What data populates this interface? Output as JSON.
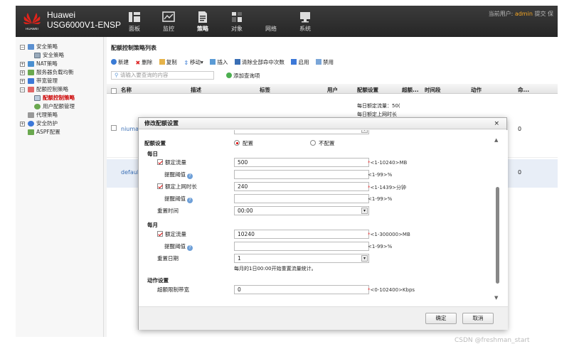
{
  "header": {
    "brand_name": "Huawei",
    "product": "USG6000V1-ENSP",
    "logo_text": "HUAWEI",
    "nav": [
      {
        "label": "面板",
        "icon": "dashboard-icon"
      },
      {
        "label": "监控",
        "icon": "monitor-icon"
      },
      {
        "label": "策略",
        "icon": "policy-icon"
      },
      {
        "label": "对象",
        "icon": "object-icon"
      },
      {
        "label": "网络",
        "icon": "network-icon"
      },
      {
        "label": "系统",
        "icon": "system-icon"
      }
    ],
    "current_user_label": "当前用户:",
    "current_user": "admin",
    "submit_label": "提交",
    "save_label": "保"
  },
  "sidebar": {
    "items": [
      {
        "label": "安全策略",
        "expander": "−"
      },
      {
        "label": "安全策略"
      },
      {
        "label": "NAT策略",
        "expander": "+"
      },
      {
        "label": "服务器负载均衡",
        "expander": "+"
      },
      {
        "label": "带宽管理",
        "expander": "+"
      },
      {
        "label": "配额控制策略",
        "expander": "−"
      },
      {
        "label": "配额控制策略"
      },
      {
        "label": "用户配额管理"
      },
      {
        "label": "代理策略"
      },
      {
        "label": "安全防护",
        "expander": "+"
      },
      {
        "label": "ASPF配置"
      }
    ]
  },
  "main": {
    "title": "配额控制策略列表",
    "toolbar": [
      "新建",
      "删除",
      "复制",
      "移动▾",
      "插入",
      "清除全部命中次数",
      "启用",
      "禁用"
    ],
    "search_placeholder": "请输入要查询的内容",
    "add_query_label": "添加查询项",
    "columns": [
      "名称",
      "描述",
      "标签",
      "用户",
      "配额设置",
      "超额...",
      "时间段",
      "动作",
      "命..."
    ],
    "rows": [
      {
        "name": "niuma",
        "quota_line1": "每日额定流量：50(",
        "quota_line2": "每日额定上网时长",
        "hits": "0"
      },
      {
        "name": "default",
        "quota_line1": "",
        "quota_line2": "",
        "hits": "0"
      }
    ]
  },
  "modal": {
    "title": "修改配额设置",
    "close_label": "×",
    "quota_section_label": "配额设置",
    "radio_on_label": "配置",
    "radio_off_label": "不配置",
    "daily_label": "每日",
    "daily_traffic_label": "额定流量",
    "daily_traffic_value": "500",
    "daily_traffic_hint": "<1-10240>MB",
    "alert_threshold_label": "提醒阈值",
    "alert_threshold_hint": "<1-99>%",
    "daily_online_label": "额定上网时长",
    "daily_online_value": "240",
    "daily_online_hint": "<1-1439>分钟",
    "alert_threshold2_label": "提醒阈值",
    "alert_threshold2_hint": "<1-99>%",
    "reset_time_label": "重置时间",
    "reset_time_value": "00:00",
    "monthly_label": "每月",
    "monthly_traffic_label": "额定流量",
    "monthly_traffic_value": "10240",
    "monthly_traffic_hint": "<1-300000>MB",
    "monthly_alert_label": "提醒阈值",
    "monthly_alert_hint": "<1-99>%",
    "reset_date_label": "重置日期",
    "reset_date_value": "1",
    "reset_note": "每月的1日00:00开始重置流量统计。",
    "action_section_label": "动作设置",
    "overquota_bw_label": "超额限制带宽",
    "overquota_bw_value": "0",
    "overquota_bw_hint": "<0-102400>Kbps",
    "ok_label": "确定",
    "cancel_label": "取消",
    "help_glyph": "?"
  },
  "watermark": "CSDN @freshman_start",
  "colors": {
    "accent_red": "#dd2222",
    "header_bg": "#2e2e2e",
    "user_highlight": "#f5a623"
  }
}
